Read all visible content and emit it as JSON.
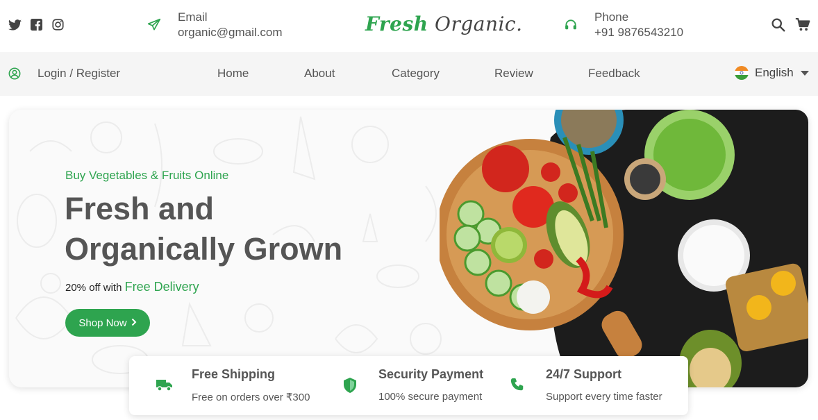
{
  "header": {
    "social": [
      "twitter-icon",
      "facebook-icon",
      "instagram-icon"
    ],
    "email": {
      "label": "Email",
      "value": "organic@gmail.com"
    },
    "logo": {
      "part1": "Fresh",
      "part2": "Organic."
    },
    "phone": {
      "label": "Phone",
      "value": "+91 9876543210"
    },
    "actions": [
      "search-icon",
      "cart-icon"
    ]
  },
  "nav": {
    "login": "Login / Register",
    "items": [
      "Home",
      "About",
      "Category",
      "Review",
      "Feedback"
    ],
    "language": "English"
  },
  "hero": {
    "kicker": "Buy Vegetables & Fruits Online",
    "title_line1": "Fresh and",
    "title_line2": "Organically Grown",
    "offer_prefix": "20% off with",
    "offer_highlight": "Free Delivery",
    "cta": "Shop Now"
  },
  "features": [
    {
      "title": "Free Shipping",
      "subtitle": "Free on orders over ₹300",
      "icon": "truck-icon"
    },
    {
      "title": "Security Payment",
      "subtitle": "100% secure payment",
      "icon": "shield-icon"
    },
    {
      "title": "24/7 Support",
      "subtitle": "Support every time faster",
      "icon": "phone-icon"
    }
  ],
  "colors": {
    "accent": "#2ea44f",
    "text": "#555555",
    "navbg": "#f5f5f5"
  }
}
